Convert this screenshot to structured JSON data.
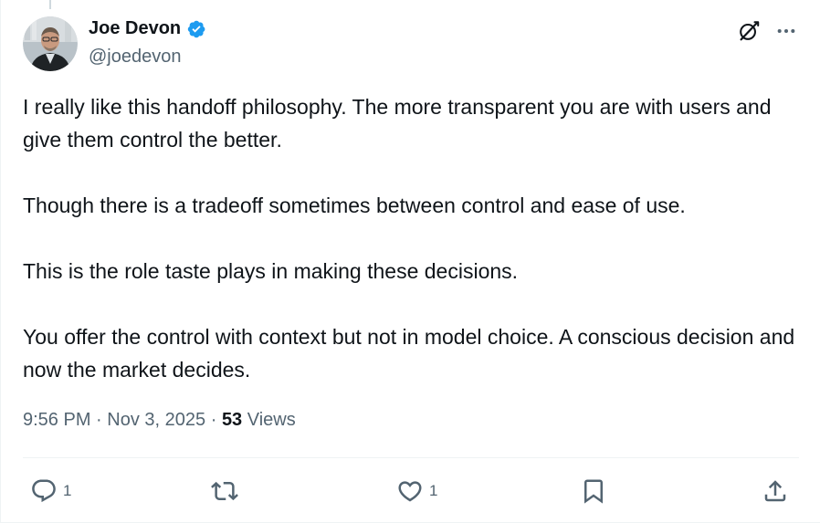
{
  "author": {
    "display_name": "Joe Devon",
    "handle": "@joedevon",
    "verified": true,
    "avatar_icon": "avatar-photo"
  },
  "header_actions": {
    "grok_icon": "grok-icon",
    "more_icon": "more-icon"
  },
  "tweet": {
    "paragraphs": [
      "I really like this handoff philosophy. The more transparent you are with users and give them control the better.",
      "Though there is a tradeoff sometimes between control and ease of use.",
      "This is the role taste plays in making these decisions.",
      "You offer the control with context but not in model choice. A conscious decision and now the market decides."
    ]
  },
  "meta": {
    "time": "9:56 PM",
    "separator": "·",
    "date": "Nov 3, 2025",
    "views_count": "53",
    "views_label": "Views"
  },
  "actions": {
    "reply_count": "1",
    "repost_count": "",
    "like_count": "1"
  },
  "colors": {
    "text_primary": "#0f1419",
    "text_secondary": "#536471",
    "verified_blue": "#1d9bf0",
    "divider": "#eff3f4"
  }
}
